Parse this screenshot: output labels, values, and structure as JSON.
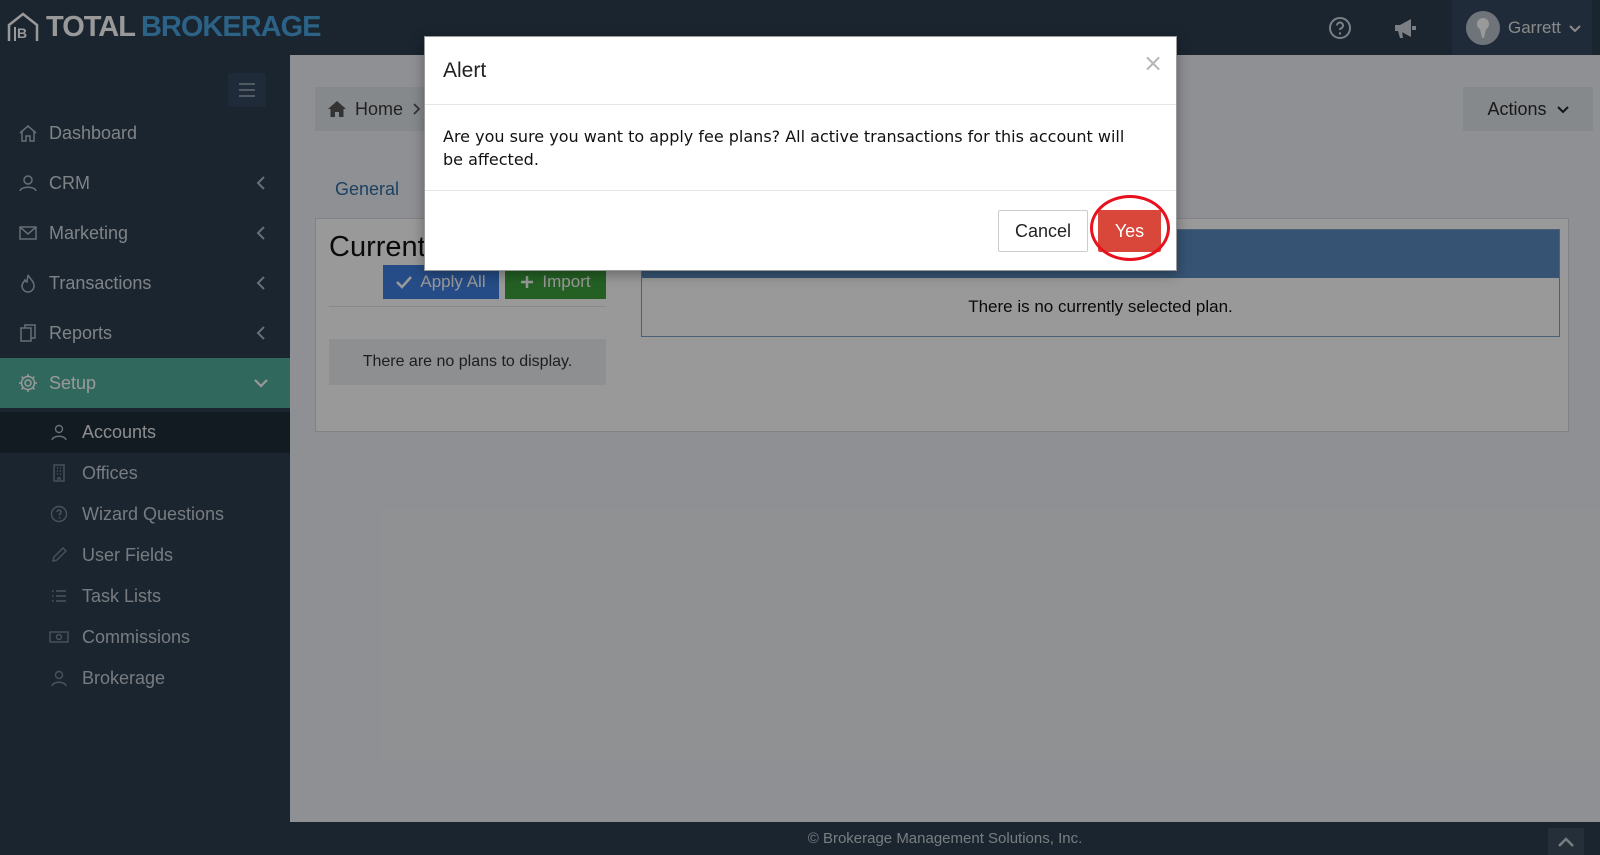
{
  "app": {
    "logo_part1": "TOTAL",
    "logo_part2": "BROKERAGE",
    "user_name": "Garrett"
  },
  "sidebar": {
    "items": [
      {
        "label": "Dashboard",
        "icon": "home-icon"
      },
      {
        "label": "CRM",
        "icon": "user-icon"
      },
      {
        "label": "Marketing",
        "icon": "envelope-icon"
      },
      {
        "label": "Transactions",
        "icon": "fire-icon"
      },
      {
        "label": "Reports",
        "icon": "copy-icon"
      },
      {
        "label": "Setup",
        "icon": "gear-icon"
      }
    ],
    "subitems": [
      {
        "label": "Accounts",
        "icon": "user-icon"
      },
      {
        "label": "Offices",
        "icon": "building-icon"
      },
      {
        "label": "Wizard Questions",
        "icon": "question-icon"
      },
      {
        "label": "User Fields",
        "icon": "pencil-icon"
      },
      {
        "label": "Task Lists",
        "icon": "list-icon"
      },
      {
        "label": "Commissions",
        "icon": "money-icon"
      },
      {
        "label": "Brokerage",
        "icon": "user-icon"
      }
    ]
  },
  "main": {
    "breadcrumb_home": "Home",
    "actions_label": "Actions",
    "tab_general": "General",
    "current_title": "Current",
    "apply_all_label": "Apply All",
    "import_label": "Import",
    "no_plans": "There are no plans to display.",
    "no_selected_plan": "There is no currently selected plan."
  },
  "modal": {
    "title": "Alert",
    "close": "×",
    "message": "Are you sure you want to apply fee plans? All active transactions for this account will be affected.",
    "cancel_label": "Cancel",
    "yes_label": "Yes"
  },
  "footer": {
    "text": "© Brokerage Management Solutions, Inc."
  },
  "colors": {
    "sidebar_bg": "#2c3e50",
    "active_nav": "#52ad9c",
    "yes_button": "#d9473b",
    "apply_button": "#3f7fe0",
    "import_button": "#3da13d",
    "highlight_ring": "#e8121e"
  }
}
